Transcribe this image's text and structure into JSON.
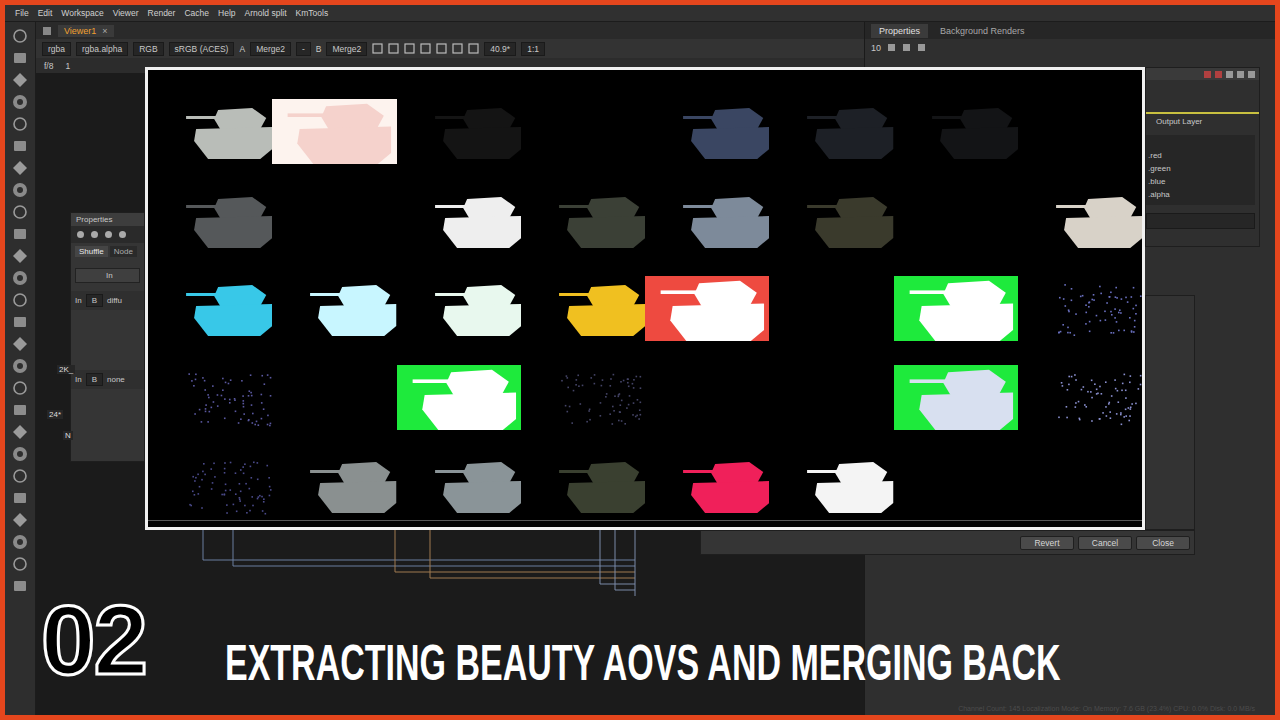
{
  "menu": [
    "File",
    "Edit",
    "Workspace",
    "Viewer",
    "Render",
    "Cache",
    "Help",
    "Arnold split",
    "KmTools"
  ],
  "viewer_tab": {
    "label": "Viewer1",
    "close": "×"
  },
  "viewer_toolbar": {
    "layer": "rgba",
    "alpha": "rgba.alpha",
    "channels": "RGB",
    "lut": "sRGB (ACES)",
    "a_label": "A",
    "a_input": "Merge2",
    "op": "-",
    "b_label": "B",
    "b_input": "Merge2",
    "zoom": "40.9*",
    "ratio": "1:1"
  },
  "viewer_row2": {
    "fstop": "f/8",
    "frame": "1"
  },
  "right_tabs": [
    {
      "label": "Properties",
      "selected": true
    },
    {
      "label": "Background Renders",
      "selected": false
    }
  ],
  "right_props": {
    "max": "10",
    "output_label": "Output Layer",
    "channels": [
      ".red",
      ".green",
      ".blue",
      ".alpha"
    ],
    "buttons": [
      "Revert",
      "Cancel",
      "Close"
    ]
  },
  "left_props": {
    "title": "Properties",
    "tabs": [
      {
        "label": "Shuffle",
        "selected": true
      },
      {
        "label": "Node",
        "selected": false
      }
    ],
    "header": "In",
    "rows": [
      {
        "label": "In",
        "input": "B",
        "value": "diffu"
      },
      {
        "label": "In",
        "input": "B",
        "value": "none"
      }
    ]
  },
  "left_labels": [
    "2K_",
    "24*",
    "N"
  ],
  "contact_sheet": {
    "tiles": [
      {
        "kind": "tank",
        "color": "#b9bdb8"
      },
      {
        "kind": "full",
        "ground": "#fdf3ee",
        "color": "#f5d2cc"
      },
      {
        "kind": "tank",
        "color": "#141414"
      },
      {
        "kind": "empty"
      },
      {
        "kind": "tank",
        "color": "#3a4662"
      },
      {
        "kind": "tank",
        "color": "#1d2026"
      },
      {
        "kind": "tank",
        "color": "#131416"
      },
      {
        "kind": "empty"
      },
      {
        "kind": "tank",
        "color": "#55585a"
      },
      {
        "kind": "empty"
      },
      {
        "kind": "tank",
        "color": "#eeeeee"
      },
      {
        "kind": "tank",
        "color": "#3b4036"
      },
      {
        "kind": "tank",
        "color": "#7d8a9a"
      },
      {
        "kind": "tank",
        "color": "#3a3a2c"
      },
      {
        "kind": "empty"
      },
      {
        "kind": "tank",
        "color": "#d8d2c8"
      },
      {
        "kind": "tank",
        "color": "#38c8e8"
      },
      {
        "kind": "tank",
        "color": "#c8f6ff"
      },
      {
        "kind": "tank",
        "color": "#e8f8ee"
      },
      {
        "kind": "tank",
        "color": "#f0c020"
      },
      {
        "kind": "full",
        "ground": "#ee4a40",
        "color": "#ffffff"
      },
      {
        "kind": "empty"
      },
      {
        "kind": "full",
        "ground": "#1eea3c",
        "color": "#ffffff"
      },
      {
        "kind": "noise",
        "color": "#6a70c0"
      },
      {
        "kind": "noise",
        "color": "#5a58a0"
      },
      {
        "kind": "empty"
      },
      {
        "kind": "full",
        "ground": "#1eea3c",
        "color": "#ffffff"
      },
      {
        "kind": "noise",
        "color": "#444466"
      },
      {
        "kind": "empty"
      },
      {
        "kind": "empty"
      },
      {
        "kind": "full",
        "ground": "#1eea3c",
        "color": "#d8e0f0"
      },
      {
        "kind": "noise",
        "color": "#8a90d0"
      },
      {
        "kind": "noise",
        "color": "#4a4a8a"
      },
      {
        "kind": "tank",
        "color": "#8a9090"
      },
      {
        "kind": "tank",
        "color": "#8a9498"
      },
      {
        "kind": "tank",
        "color": "#3a4030"
      },
      {
        "kind": "tank",
        "color": "#f0205a"
      },
      {
        "kind": "tank",
        "color": "#f4f4f4"
      },
      {
        "kind": "empty"
      },
      {
        "kind": "empty"
      }
    ]
  },
  "title": {
    "number": "02",
    "text": "EXTRACTING BEAUTY AOVS AND MERGING BACK"
  },
  "status": "Channel Count: 145  Localization Mode: On  Memory: 7.6 GB (23.4%)  CPU: 0.0%  Disk: 0.0 MB/s"
}
